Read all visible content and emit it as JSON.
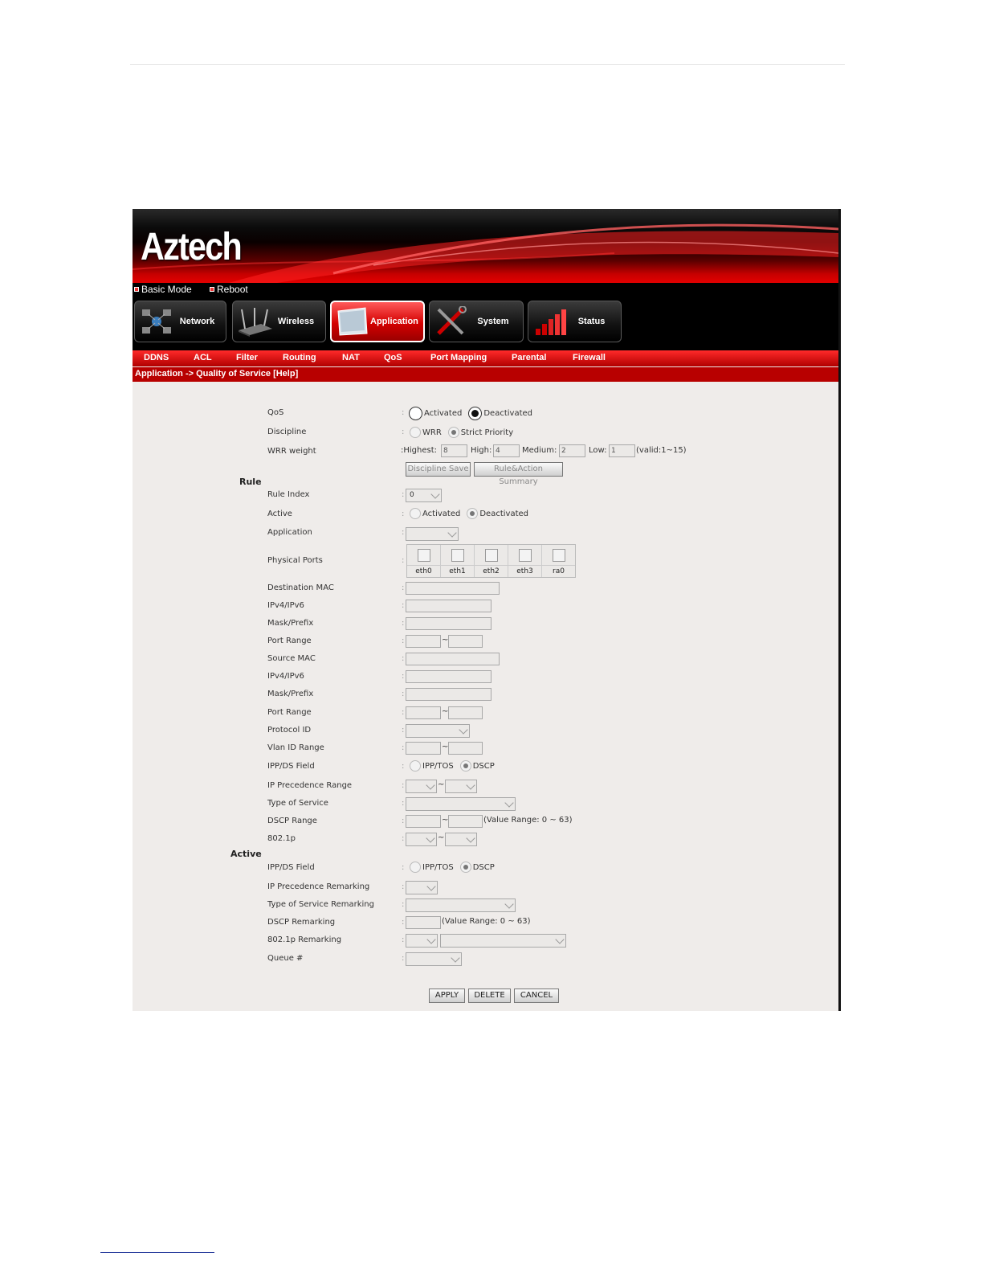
{
  "brand": "Aztech",
  "top_links": [
    "Basic Mode",
    "Reboot"
  ],
  "nav": [
    {
      "label": "Network",
      "icon": "network-icon",
      "active": false
    },
    {
      "label": "Wireless",
      "icon": "wireless-router-icon",
      "active": false
    },
    {
      "label": "Application",
      "icon": "application-icon",
      "active": true
    },
    {
      "label": "System",
      "icon": "tools-icon",
      "active": false
    },
    {
      "label": "Status",
      "icon": "status-bars-icon",
      "active": false
    }
  ],
  "subnav": [
    "DDNS",
    "ACL",
    "Filter",
    "Routing",
    "NAT",
    "QoS",
    "Port Mapping",
    "Parental",
    "Firewall"
  ],
  "breadcrumb": "Application -> Quality of Service [Help]",
  "colon": ":",
  "tilde": "~",
  "qos": {
    "label": "QoS",
    "activated": "Activated",
    "deactivated": "Deactivated"
  },
  "discipline": {
    "label": "Discipline",
    "wrr": "WRR",
    "strict": "Strict Priority"
  },
  "wrr_weight": {
    "label": "WRR weight",
    "highest_label": "Highest:",
    "highest": "8",
    "high_label": "High:",
    "high": "4",
    "medium_label": "Medium:",
    "medium": "2",
    "low_label": "Low:",
    "low": "1",
    "valid": "(valid:1~15)"
  },
  "buttons": {
    "discipline_save": "Discipline Save",
    "summary": "Rule&Action Summary",
    "apply": "APPLY",
    "delete": "DELETE",
    "cancel": "CANCEL"
  },
  "rule": {
    "title": "Rule",
    "rule_index": "Rule Index",
    "rule_index_value": "0",
    "active": "Active",
    "active_activated": "Activated",
    "active_deactivated": "Deactivated",
    "application": "Application",
    "physical_ports": "Physical Ports",
    "ports": [
      "eth0",
      "eth1",
      "eth2",
      "eth3",
      "ra0"
    ],
    "dest_mac": "Destination MAC",
    "dest_ip": "IPv4/IPv6",
    "dest_mask": "Mask/Prefix",
    "dest_port": "Port Range",
    "src_mac": "Source MAC",
    "src_ip": "IPv4/IPv6",
    "src_mask": "Mask/Prefix",
    "src_port": "Port Range",
    "protocol": "Protocol ID",
    "vlan": "Vlan ID Range",
    "ippds": "IPP/DS Field",
    "ipptos": "IPP/TOS",
    "dscp": "DSCP",
    "ip_prec": "IP Precedence Range",
    "tos": "Type of Service",
    "dscp_range": "DSCP Range",
    "dscp_range_note": "(Value Range: 0 ~ 63)",
    "dot1p": "802.1p"
  },
  "action": {
    "title": "Active",
    "ippds": "IPP/DS Field",
    "ipptos": "IPP/TOS",
    "dscp": "DSCP",
    "ip_prec_remark": "IP Precedence Remarking",
    "tos_remark": "Type of Service Remarking",
    "dscp_remark": "DSCP Remarking",
    "dscp_remark_note": "(Value Range: 0 ~ 63)",
    "dot1p_remark": "802.1p Remarking",
    "queue": "Queue #"
  }
}
